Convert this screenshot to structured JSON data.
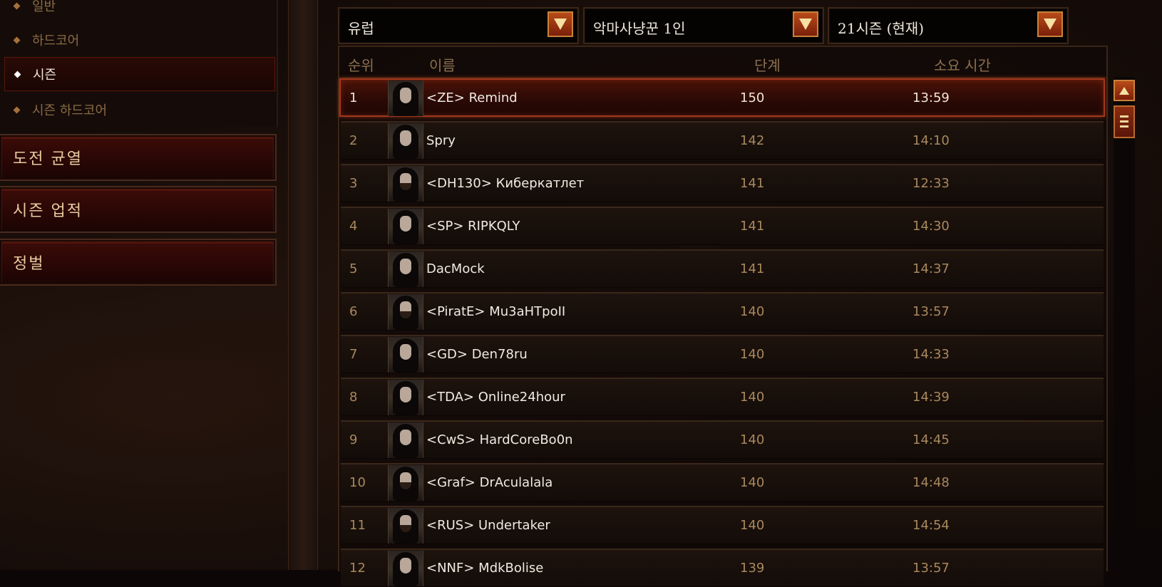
{
  "sidebar": {
    "sub_items": [
      {
        "label": "일반",
        "active": false
      },
      {
        "label": "하드코어",
        "active": false
      },
      {
        "label": "시즌",
        "active": true
      },
      {
        "label": "시즌 하드코어",
        "active": false
      }
    ],
    "buttons": [
      "도전 균열",
      "시즌 업적",
      "정벌"
    ]
  },
  "filters": {
    "region": "유럽",
    "class": "악마사냥꾼 1인",
    "season": "21시즌 (현재)"
  },
  "table": {
    "headers": {
      "rank": "순위",
      "name": "이름",
      "level": "단계",
      "time": "소요 시간"
    },
    "rows": [
      {
        "rank": "1",
        "name": "<ZE> Remind",
        "level": "150",
        "time": "13:59",
        "portrait": "female"
      },
      {
        "rank": "2",
        "name": "Spry",
        "level": "142",
        "time": "14:10",
        "portrait": "female"
      },
      {
        "rank": "3",
        "name": "<DH130> Киберкатлет",
        "level": "141",
        "time": "12:33",
        "portrait": "male"
      },
      {
        "rank": "4",
        "name": "<SP> RIPKQLY",
        "level": "141",
        "time": "14:30",
        "portrait": "female"
      },
      {
        "rank": "5",
        "name": "DacMock",
        "level": "141",
        "time": "14:37",
        "portrait": "female"
      },
      {
        "rank": "6",
        "name": "<PiratE> Mu3aHTpoII",
        "level": "140",
        "time": "13:57",
        "portrait": "male"
      },
      {
        "rank": "7",
        "name": "<GD> Den78ru",
        "level": "140",
        "time": "14:33",
        "portrait": "female"
      },
      {
        "rank": "8",
        "name": "<TDA> Online24hour",
        "level": "140",
        "time": "14:39",
        "portrait": "female"
      },
      {
        "rank": "9",
        "name": "<CwS> HardCoreBo0n",
        "level": "140",
        "time": "14:45",
        "portrait": "female"
      },
      {
        "rank": "10",
        "name": "<Graf> DrAculalala",
        "level": "140",
        "time": "14:48",
        "portrait": "male"
      },
      {
        "rank": "11",
        "name": "<RUS> Undertaker",
        "level": "140",
        "time": "14:54",
        "portrait": "male"
      },
      {
        "rank": "12",
        "name": "<NNF> MdkBolise",
        "level": "139",
        "time": "13:57",
        "portrait": "female"
      }
    ],
    "selected_rank": "1"
  },
  "icons": {
    "dropdown": "chevron-down-icon",
    "scroll_up": "arrow-up-icon",
    "scroll_thumb": "scroll-thumb-icon",
    "portrait": "hero-portrait-icon"
  },
  "colors": {
    "accent": "#b84b18",
    "accent_border": "#c9823a",
    "selected_row": "#4a1208",
    "text_muted": "#a8885e",
    "text_bright": "#f0eae2"
  }
}
